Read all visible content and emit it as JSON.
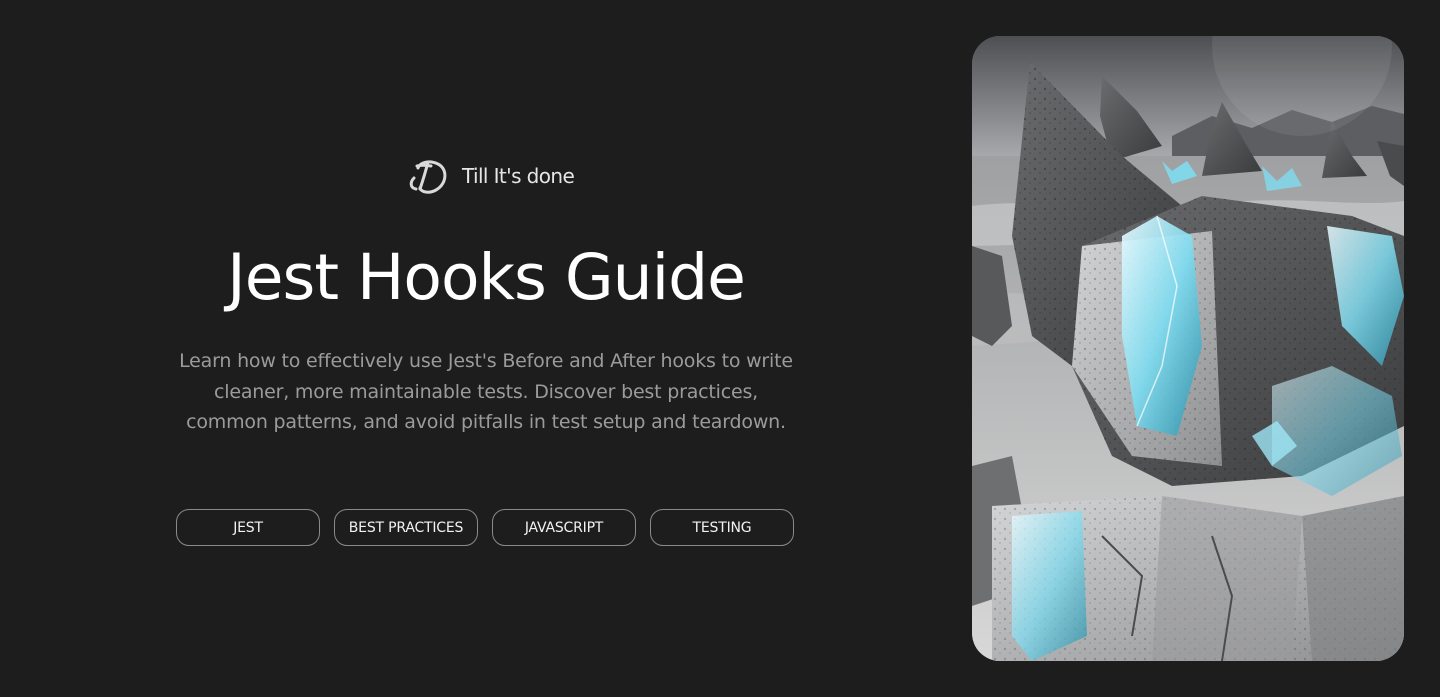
{
  "brand": {
    "name": "Till It's done",
    "logo_icon": "td-monogram-icon"
  },
  "hero": {
    "title": "Jest Hooks Guide",
    "description": "Learn how to effectively use Jest's Before and After hooks to write cleaner, more maintainable tests. Discover best practices, common patterns, and avoid pitfalls in test setup and teardown."
  },
  "tags": [
    {
      "label": "JEST"
    },
    {
      "label": "BEST PRACTICES"
    },
    {
      "label": "JAVASCRIPT"
    },
    {
      "label": "TESTING"
    }
  ],
  "image": {
    "subject": "crystal-rock-landscape-image"
  },
  "colors": {
    "background": "#1d1d1d",
    "title": "#ffffff",
    "description": "#9b9b9b",
    "tag_border": "#8a8a8a",
    "crystal_accent": "#5ad8f0"
  }
}
